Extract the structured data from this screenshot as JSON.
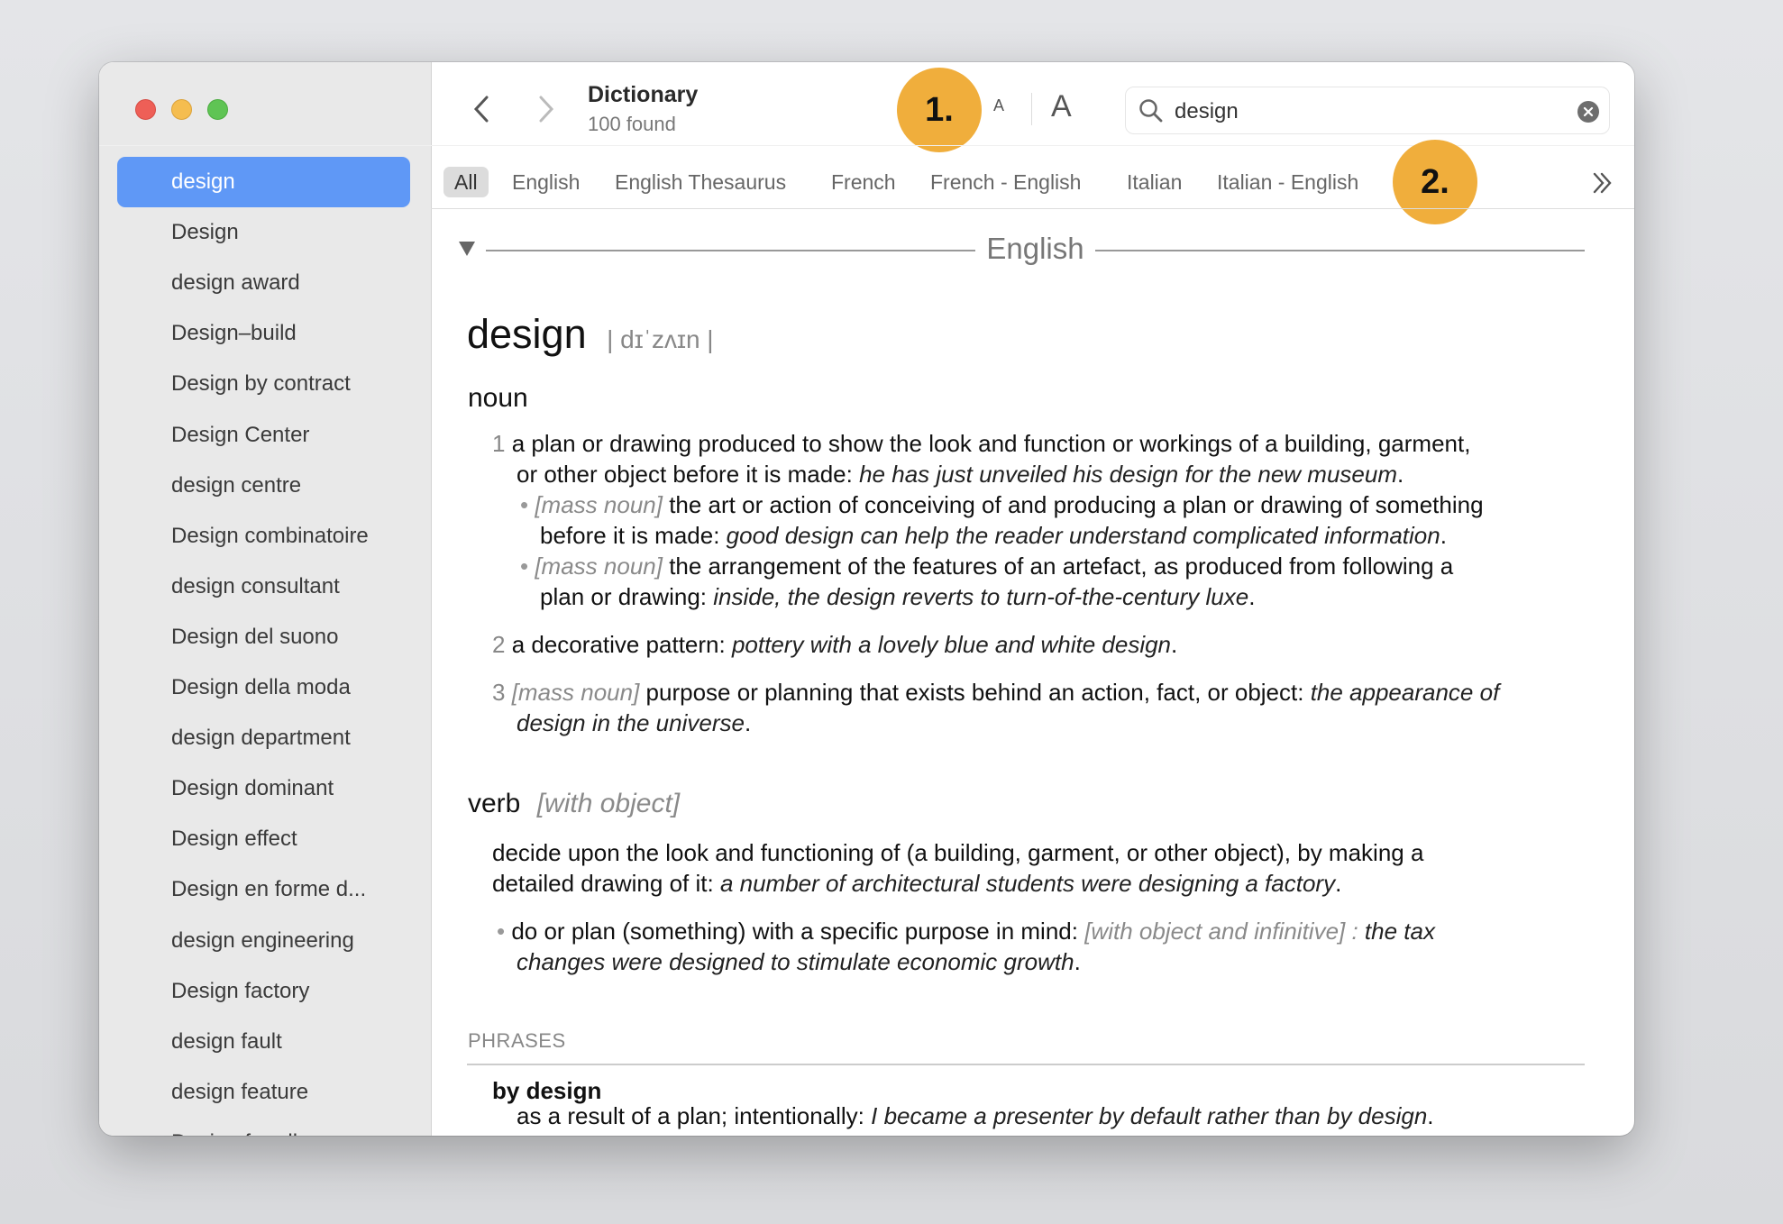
{
  "window": {
    "controls": {
      "close_color": "#ee5f57",
      "minimize_color": "#f5bd4f",
      "zoom_color": "#5fc454"
    }
  },
  "sidebar": {
    "selected_color": "#5f98f6",
    "items": [
      "design",
      "Design",
      "design award",
      "Design–build",
      "Design by contract",
      "Design Center",
      "design centre",
      "Design combinatoire",
      "design consultant",
      "Design del suono",
      "Design della moda",
      "design department",
      "Design dominant",
      "Design effect",
      "Design en forme d...",
      "design engineering",
      "Design factory",
      "design fault",
      "design feature",
      "Design for all"
    ],
    "selected_index": 0
  },
  "toolbar": {
    "back_icon": "chevron-left-icon",
    "forward_icon": "chevron-right-icon",
    "title": "Dictionary",
    "subtitle": "100 found",
    "font_small": "A",
    "font_large": "A",
    "search": {
      "value": "design",
      "icon": "magnifier-icon",
      "clear_icon": "clear-circle-icon"
    }
  },
  "annotations": {
    "badge1": "1.",
    "badge2": "2.",
    "color": "#f0ae3c"
  },
  "tabs": {
    "items": [
      "All",
      "English",
      "English Thesaurus",
      "French",
      "French - English",
      "Italian",
      "Italian - English"
    ],
    "active": "All",
    "more_icon": "double-chevron-right-icon"
  },
  "entry": {
    "section": "English",
    "headword": "design",
    "pronunciation": "| dɪˈzʌɪn |",
    "noun_label": "noun",
    "verb_label": "verb",
    "verb_note": "[with object]",
    "phrases_label": "PHRASES",
    "phrase": "by design",
    "lines": [
      [
        [
          "num",
          "1 "
        ],
        [
          "n",
          "a plan or drawing produced to show the look and function or workings of a building, garment,"
        ]
      ],
      [
        [
          "n",
          "or other object before it is made: "
        ],
        [
          "i",
          "he has just unveiled his design for the new museum"
        ],
        [
          "n",
          "."
        ]
      ],
      [
        [
          "bul",
          "• "
        ],
        [
          "g",
          "[mass noun]"
        ],
        [
          "n",
          " the art or action of conceiving of and producing a plan or drawing of something"
        ]
      ],
      [
        [
          "n",
          "before it is made: "
        ],
        [
          "i",
          "good design can help the reader understand complicated information"
        ],
        [
          "n",
          "."
        ]
      ],
      [
        [
          "bul",
          "• "
        ],
        [
          "g",
          "[mass noun]"
        ],
        [
          "n",
          " the arrangement of the features of an artefact, as produced from following a"
        ]
      ],
      [
        [
          "n",
          "plan or drawing: "
        ],
        [
          "i",
          "inside, the design reverts to turn-of-the-century luxe"
        ],
        [
          "n",
          "."
        ]
      ],
      [
        [
          "num",
          "2 "
        ],
        [
          "n",
          "a decorative pattern: "
        ],
        [
          "i",
          "pottery with a lovely blue and white design"
        ],
        [
          "n",
          "."
        ]
      ],
      [
        [
          "num",
          "3 "
        ],
        [
          "g",
          "[mass noun]"
        ],
        [
          "n",
          " purpose or planning that exists behind an action, fact, or object: "
        ],
        [
          "i",
          "the appearance of"
        ]
      ],
      [
        [
          "i",
          "design in the universe"
        ],
        [
          "n",
          "."
        ]
      ],
      [
        [
          "n",
          "decide upon the look and functioning of (a building, garment, or other object), by making a"
        ]
      ],
      [
        [
          "n",
          "detailed drawing of it: "
        ],
        [
          "i",
          "a number of architectural students were designing a factory"
        ],
        [
          "n",
          "."
        ]
      ],
      [
        [
          "bul",
          "• "
        ],
        [
          "n",
          "do or plan (something) with a specific purpose in mind: "
        ],
        [
          "g",
          "[with object and infinitive] : "
        ],
        [
          "i",
          "the tax"
        ]
      ],
      [
        [
          "i",
          "changes were designed to stimulate economic growth"
        ],
        [
          "n",
          "."
        ]
      ],
      [
        [
          "n",
          "as a result of a plan; intentionally: "
        ],
        [
          "i",
          "I became a presenter by default rather than by design"
        ],
        [
          "n",
          "."
        ]
      ]
    ]
  }
}
